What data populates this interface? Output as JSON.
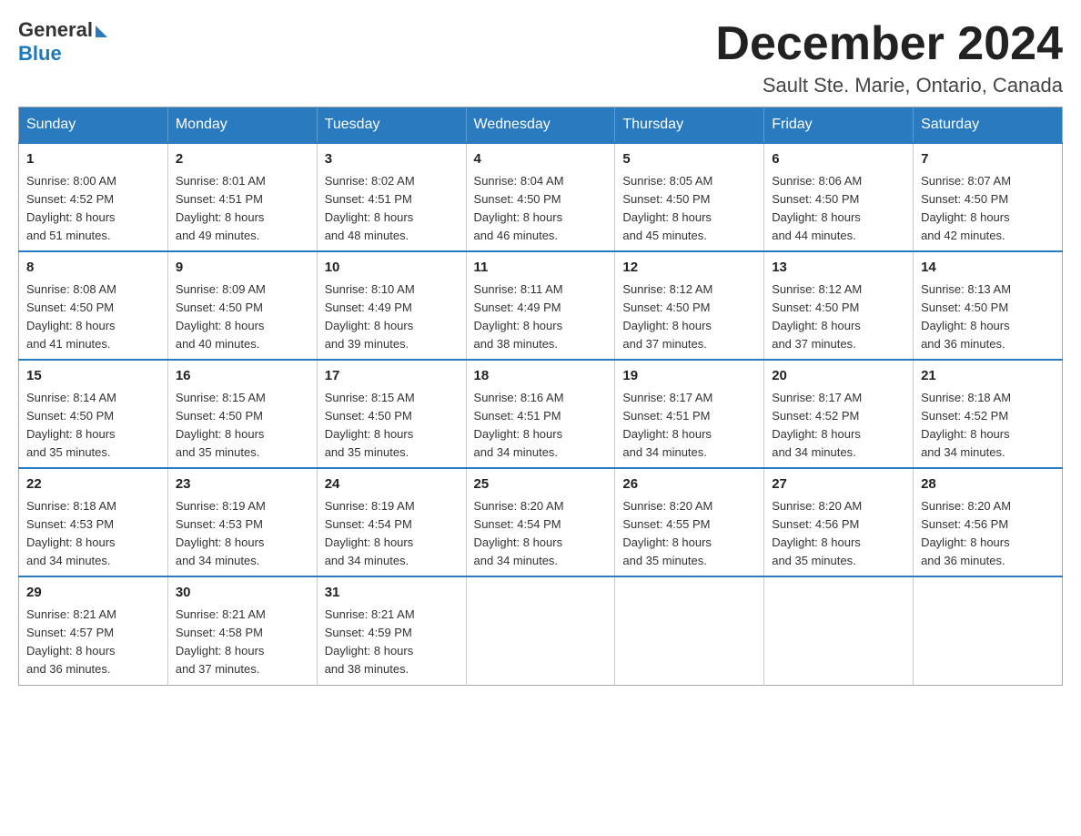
{
  "header": {
    "logo_line1": "General",
    "logo_line2": "Blue",
    "month_title": "December 2024",
    "location": "Sault Ste. Marie, Ontario, Canada"
  },
  "weekdays": [
    "Sunday",
    "Monday",
    "Tuesday",
    "Wednesday",
    "Thursday",
    "Friday",
    "Saturday"
  ],
  "weeks": [
    [
      {
        "day": "1",
        "sunrise": "8:00 AM",
        "sunset": "4:52 PM",
        "daylight": "8 hours and 51 minutes."
      },
      {
        "day": "2",
        "sunrise": "8:01 AM",
        "sunset": "4:51 PM",
        "daylight": "8 hours and 49 minutes."
      },
      {
        "day": "3",
        "sunrise": "8:02 AM",
        "sunset": "4:51 PM",
        "daylight": "8 hours and 48 minutes."
      },
      {
        "day": "4",
        "sunrise": "8:04 AM",
        "sunset": "4:50 PM",
        "daylight": "8 hours and 46 minutes."
      },
      {
        "day": "5",
        "sunrise": "8:05 AM",
        "sunset": "4:50 PM",
        "daylight": "8 hours and 45 minutes."
      },
      {
        "day": "6",
        "sunrise": "8:06 AM",
        "sunset": "4:50 PM",
        "daylight": "8 hours and 44 minutes."
      },
      {
        "day": "7",
        "sunrise": "8:07 AM",
        "sunset": "4:50 PM",
        "daylight": "8 hours and 42 minutes."
      }
    ],
    [
      {
        "day": "8",
        "sunrise": "8:08 AM",
        "sunset": "4:50 PM",
        "daylight": "8 hours and 41 minutes."
      },
      {
        "day": "9",
        "sunrise": "8:09 AM",
        "sunset": "4:50 PM",
        "daylight": "8 hours and 40 minutes."
      },
      {
        "day": "10",
        "sunrise": "8:10 AM",
        "sunset": "4:49 PM",
        "daylight": "8 hours and 39 minutes."
      },
      {
        "day": "11",
        "sunrise": "8:11 AM",
        "sunset": "4:49 PM",
        "daylight": "8 hours and 38 minutes."
      },
      {
        "day": "12",
        "sunrise": "8:12 AM",
        "sunset": "4:50 PM",
        "daylight": "8 hours and 37 minutes."
      },
      {
        "day": "13",
        "sunrise": "8:12 AM",
        "sunset": "4:50 PM",
        "daylight": "8 hours and 37 minutes."
      },
      {
        "day": "14",
        "sunrise": "8:13 AM",
        "sunset": "4:50 PM",
        "daylight": "8 hours and 36 minutes."
      }
    ],
    [
      {
        "day": "15",
        "sunrise": "8:14 AM",
        "sunset": "4:50 PM",
        "daylight": "8 hours and 35 minutes."
      },
      {
        "day": "16",
        "sunrise": "8:15 AM",
        "sunset": "4:50 PM",
        "daylight": "8 hours and 35 minutes."
      },
      {
        "day": "17",
        "sunrise": "8:15 AM",
        "sunset": "4:50 PM",
        "daylight": "8 hours and 35 minutes."
      },
      {
        "day": "18",
        "sunrise": "8:16 AM",
        "sunset": "4:51 PM",
        "daylight": "8 hours and 34 minutes."
      },
      {
        "day": "19",
        "sunrise": "8:17 AM",
        "sunset": "4:51 PM",
        "daylight": "8 hours and 34 minutes."
      },
      {
        "day": "20",
        "sunrise": "8:17 AM",
        "sunset": "4:52 PM",
        "daylight": "8 hours and 34 minutes."
      },
      {
        "day": "21",
        "sunrise": "8:18 AM",
        "sunset": "4:52 PM",
        "daylight": "8 hours and 34 minutes."
      }
    ],
    [
      {
        "day": "22",
        "sunrise": "8:18 AM",
        "sunset": "4:53 PM",
        "daylight": "8 hours and 34 minutes."
      },
      {
        "day": "23",
        "sunrise": "8:19 AM",
        "sunset": "4:53 PM",
        "daylight": "8 hours and 34 minutes."
      },
      {
        "day": "24",
        "sunrise": "8:19 AM",
        "sunset": "4:54 PM",
        "daylight": "8 hours and 34 minutes."
      },
      {
        "day": "25",
        "sunrise": "8:20 AM",
        "sunset": "4:54 PM",
        "daylight": "8 hours and 34 minutes."
      },
      {
        "day": "26",
        "sunrise": "8:20 AM",
        "sunset": "4:55 PM",
        "daylight": "8 hours and 35 minutes."
      },
      {
        "day": "27",
        "sunrise": "8:20 AM",
        "sunset": "4:56 PM",
        "daylight": "8 hours and 35 minutes."
      },
      {
        "day": "28",
        "sunrise": "8:20 AM",
        "sunset": "4:56 PM",
        "daylight": "8 hours and 36 minutes."
      }
    ],
    [
      {
        "day": "29",
        "sunrise": "8:21 AM",
        "sunset": "4:57 PM",
        "daylight": "8 hours and 36 minutes."
      },
      {
        "day": "30",
        "sunrise": "8:21 AM",
        "sunset": "4:58 PM",
        "daylight": "8 hours and 37 minutes."
      },
      {
        "day": "31",
        "sunrise": "8:21 AM",
        "sunset": "4:59 PM",
        "daylight": "8 hours and 38 minutes."
      },
      null,
      null,
      null,
      null
    ]
  ],
  "labels": {
    "sunrise": "Sunrise:",
    "sunset": "Sunset:",
    "daylight": "Daylight:"
  }
}
